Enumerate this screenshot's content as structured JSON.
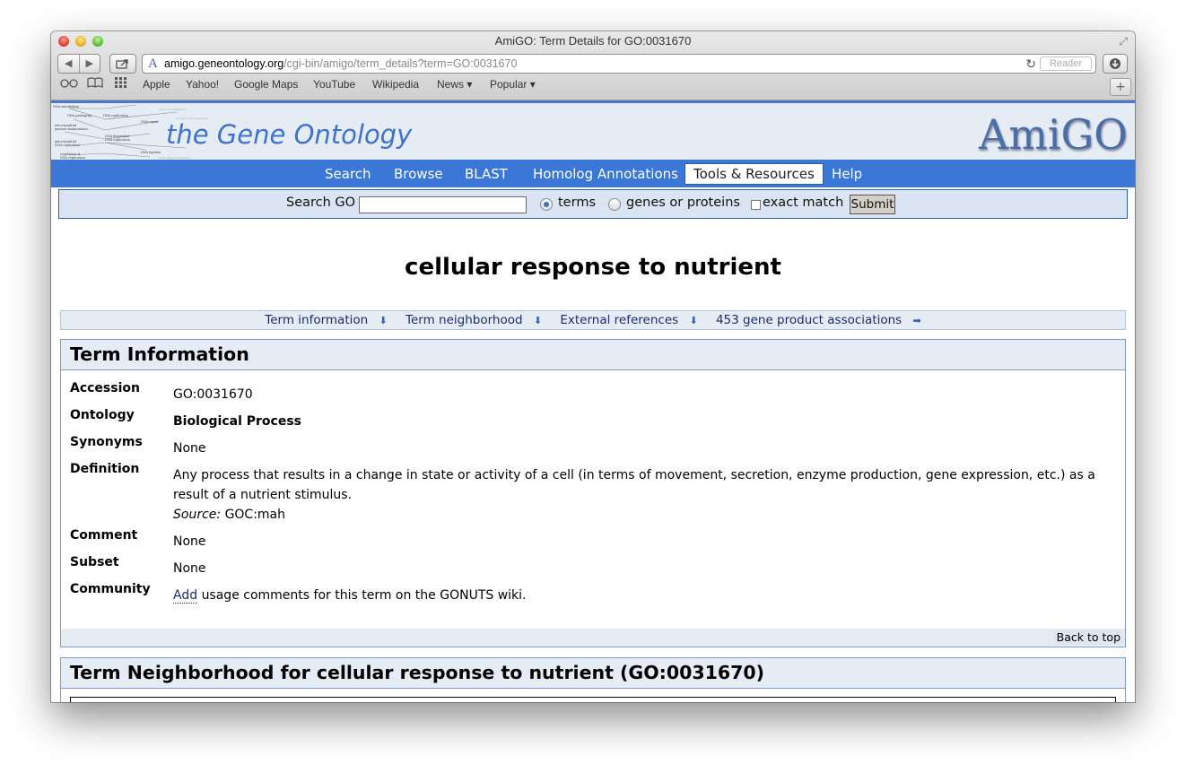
{
  "window": {
    "title": "AmiGO: Term Details for GO:0031670"
  },
  "toolbar": {
    "url_domain": "amigo.geneontology.org",
    "url_path": "/cgi-bin/amigo/term_details?term=GO:0031670",
    "reader_label": "Reader",
    "url_icon_letter": "A"
  },
  "bookmarks": {
    "items": [
      "Apple",
      "Yahoo!",
      "Google Maps",
      "YouTube",
      "Wikipedia",
      "News ▾",
      "Popular ▾"
    ]
  },
  "header": {
    "site_title": "the Gene Ontology",
    "logo_text": "AmiGO"
  },
  "nav": {
    "items": [
      "Search",
      "Browse",
      "BLAST",
      "Homolog Annotations",
      "Tools & Resources",
      "Help"
    ],
    "active": "Tools & Resources"
  },
  "search": {
    "label": "Search GO",
    "value": "",
    "option_terms": "terms",
    "option_genes": "genes or proteins",
    "selected_option": "terms",
    "exact_match_label": "exact match",
    "exact_match_checked": false,
    "submit_label": "Submit"
  },
  "term": {
    "name": "cellular response to nutrient"
  },
  "jump_links": {
    "term_information": "Term information",
    "term_neighborhood": "Term neighborhood",
    "external_references": "External references",
    "gene_products": "453 gene product associations"
  },
  "term_info": {
    "heading": "Term Information",
    "rows": {
      "accession": {
        "label": "Accession",
        "value": "GO:0031670"
      },
      "ontology": {
        "label": "Ontology",
        "value": "Biological Process"
      },
      "synonyms": {
        "label": "Synonyms",
        "value": "None"
      },
      "definition": {
        "label": "Definition",
        "value": "Any process that results in a change in state or activity of a cell (in terms of movement, secretion, enzyme production, gene expression, etc.) as a result of a nutrient stimulus.",
        "source_label": "Source:",
        "source_value": "GOC:mah"
      },
      "comment": {
        "label": "Comment",
        "value": "None"
      },
      "subset": {
        "label": "Subset",
        "value": "None"
      },
      "community": {
        "label": "Community",
        "link": "Add",
        "text": "usage comments for this term on the GONUTS wiki."
      }
    },
    "back_to_top": "Back to top"
  },
  "term_neighborhood": {
    "heading": "Term Neighborhood for cellular response to nutrient (GO:0031670)"
  }
}
